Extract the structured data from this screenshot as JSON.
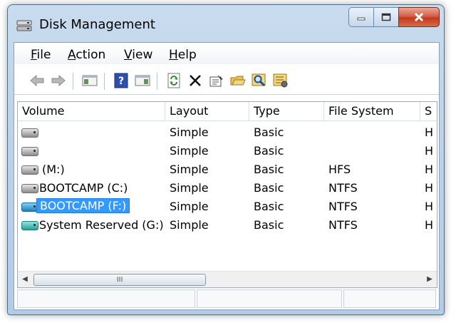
{
  "window": {
    "title": "Disk Management"
  },
  "menu": [
    {
      "accel": "F",
      "rest": "ile"
    },
    {
      "accel": "A",
      "rest": "ction"
    },
    {
      "accel": "V",
      "rest": "iew"
    },
    {
      "accel": "H",
      "rest": "elp"
    }
  ],
  "toolbar": {
    "icons": [
      "back-arrow-icon",
      "forward-arrow-icon",
      "console-tree-icon",
      "help-icon",
      "action-pane-icon",
      "refresh-icon",
      "delete-icon",
      "properties-icon",
      "open-folder-icon",
      "search-icon",
      "settings-icon"
    ]
  },
  "table": {
    "headers": [
      "Volume",
      "Layout",
      "Type",
      "File System",
      "S"
    ],
    "rows": [
      {
        "volume": "",
        "icon": "gray",
        "layout": "Simple",
        "type": "Basic",
        "fs": "",
        "status": "H"
      },
      {
        "volume": "",
        "icon": "gray",
        "layout": "Simple",
        "type": "Basic",
        "fs": "",
        "status": "H"
      },
      {
        "volume": "(M:)",
        "icon": "gray",
        "layout": "Simple",
        "type": "Basic",
        "fs": "HFS",
        "status": "H"
      },
      {
        "volume": "BOOTCAMP (C:)",
        "icon": "gray",
        "layout": "Simple",
        "type": "Basic",
        "fs": "NTFS",
        "status": "H"
      },
      {
        "volume": "BOOTCAMP (F:)",
        "icon": "blue",
        "layout": "Simple",
        "type": "Basic",
        "fs": "NTFS",
        "status": "H",
        "selected": true
      },
      {
        "volume": "System Reserved (G:)",
        "icon": "teal",
        "layout": "Simple",
        "type": "Basic",
        "fs": "NTFS",
        "status": "H"
      }
    ]
  },
  "scrollbar": {
    "thumb_grip": "III"
  },
  "colors": {
    "selection": "#3399ff",
    "title_bar": "#bcd3ea",
    "close_button": "#c23a1c"
  }
}
